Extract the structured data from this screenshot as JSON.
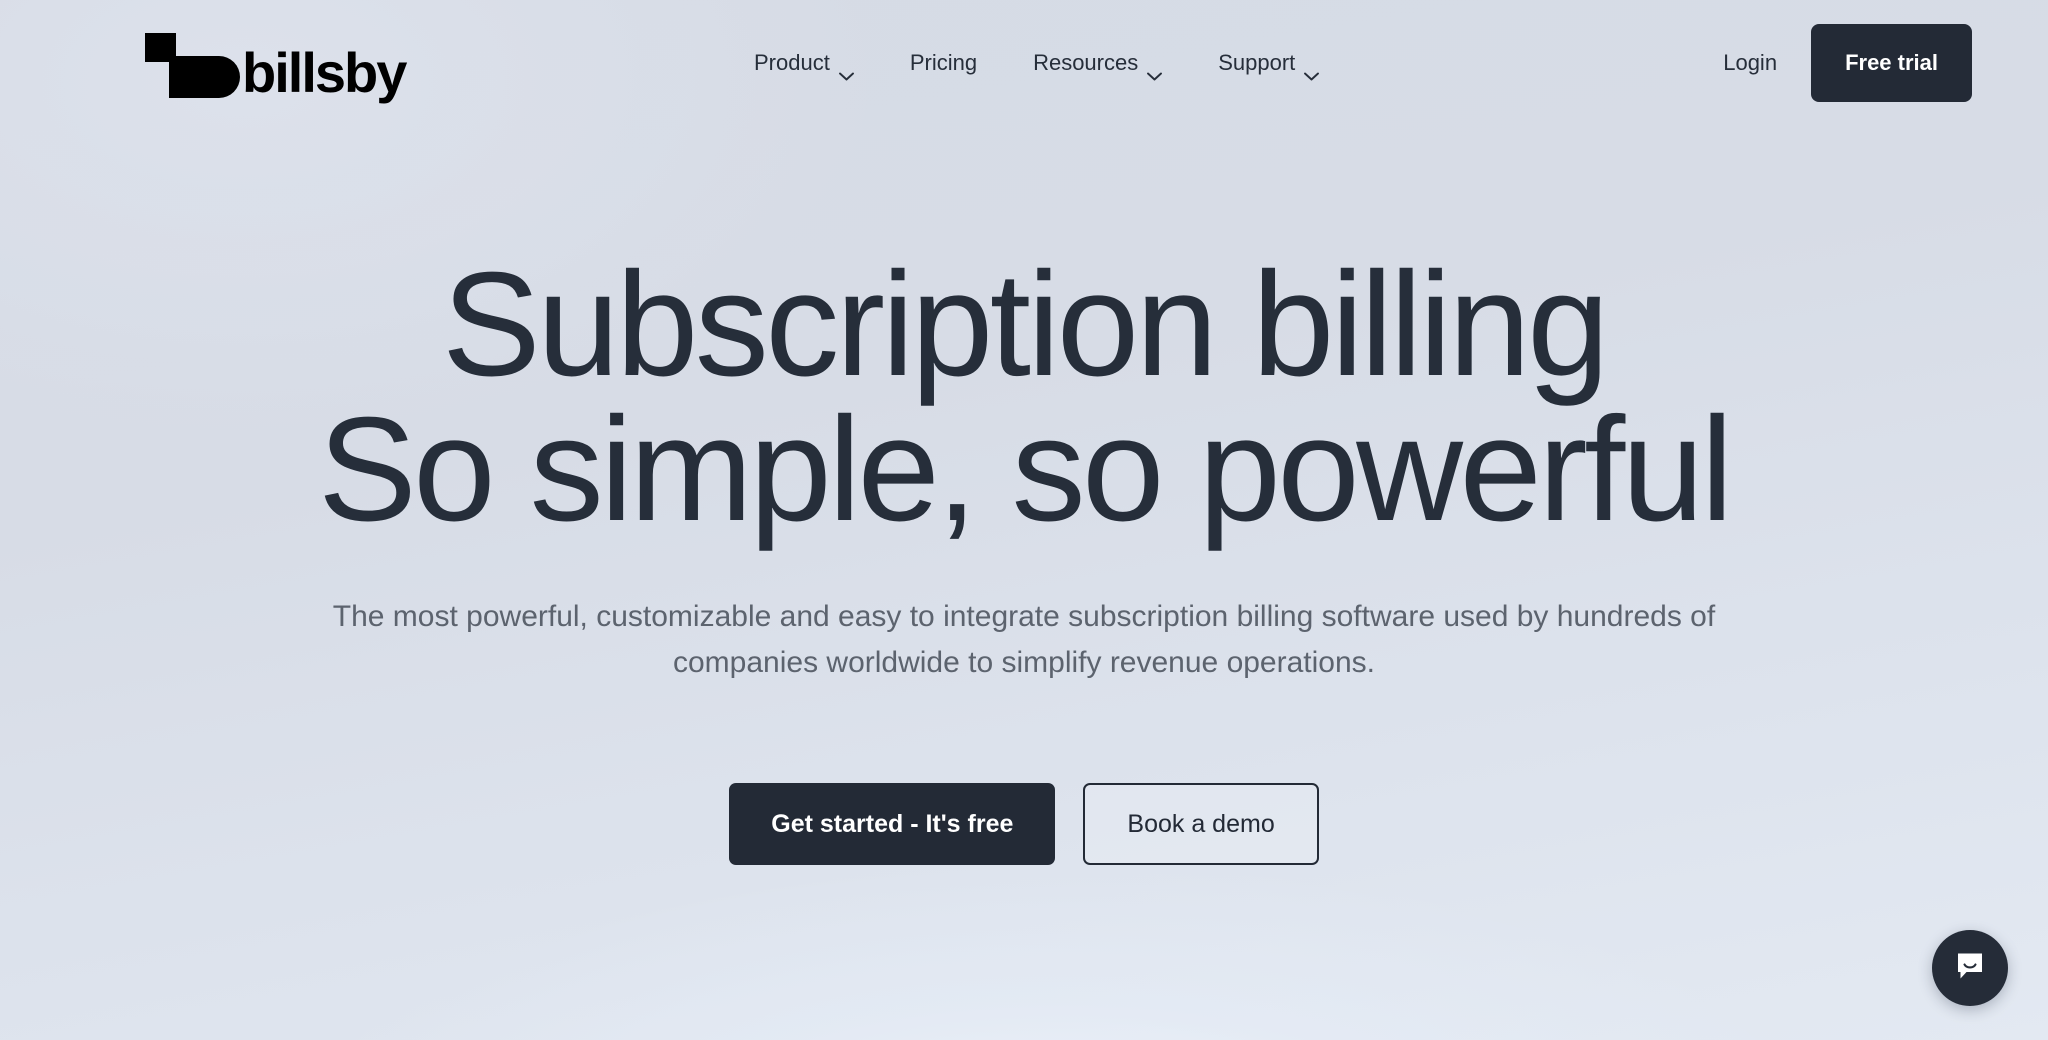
{
  "header": {
    "logo": {
      "wordmark": "billsby",
      "mark_icon": "billsby-logo-mark"
    },
    "nav": [
      {
        "label": "Product",
        "has_dropdown": true,
        "icon": "chevron-down-icon"
      },
      {
        "label": "Pricing",
        "has_dropdown": false,
        "icon": ""
      },
      {
        "label": "Resources",
        "has_dropdown": true,
        "icon": "chevron-down-icon"
      },
      {
        "label": "Support",
        "has_dropdown": true,
        "icon": "chevron-down-icon"
      }
    ],
    "login_label": "Login",
    "free_trial_label": "Free trial"
  },
  "hero": {
    "headline_line1": "Subscription billing",
    "headline_line2": "So simple, so powerful",
    "subheading": "The most powerful, customizable and easy to integrate subscription billing software used by hundreds of companies worldwide to simplify revenue operations.",
    "primary_cta": "Get started - It's free",
    "secondary_cta": "Book a demo"
  },
  "chat": {
    "icon": "chat-bubble-smile-icon"
  },
  "colors": {
    "dark": "#232a36",
    "headline": "#262e3a",
    "subheading": "#5c636e",
    "background_top": "#d6dbe5",
    "background_bottom": "#e3e9f2",
    "button_text": "#ffffff"
  }
}
